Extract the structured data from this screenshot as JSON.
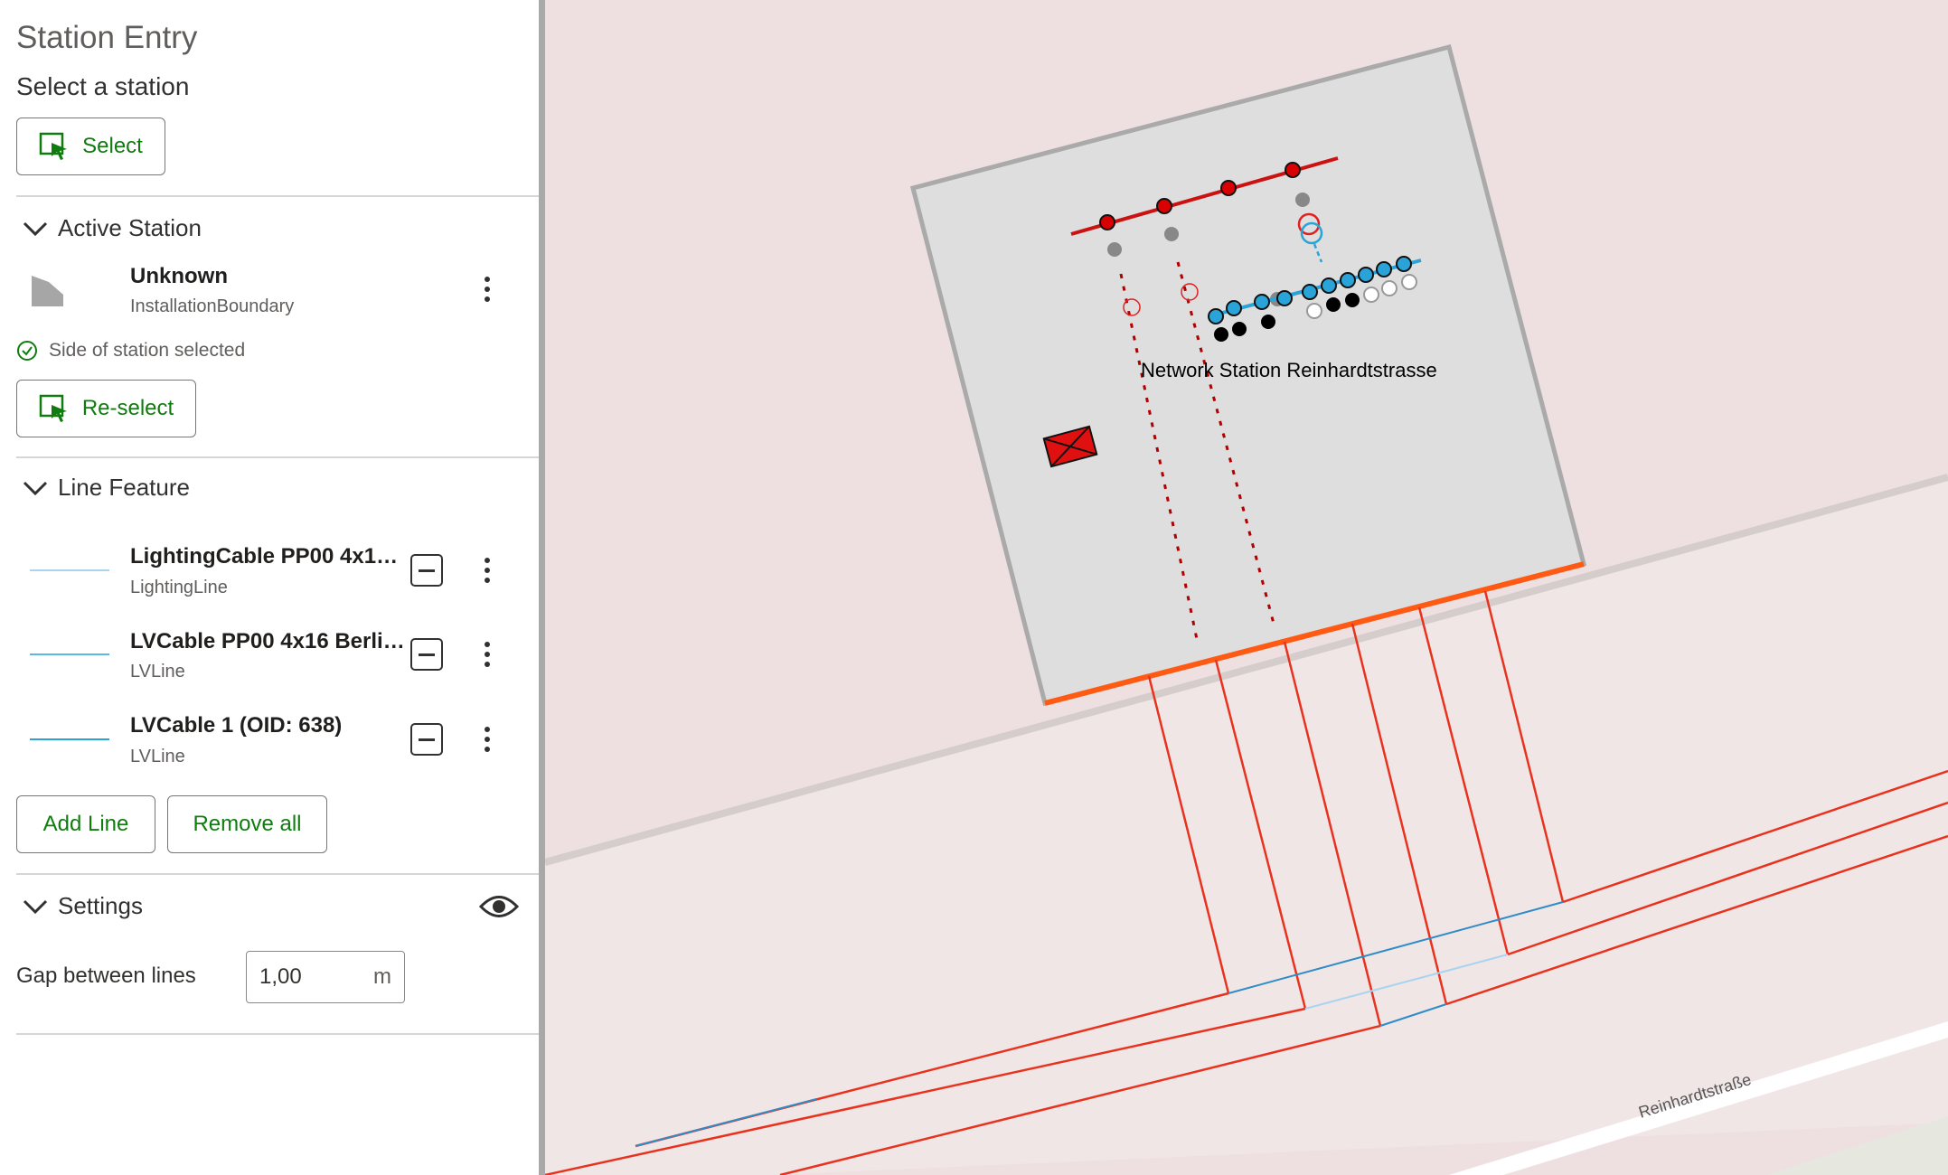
{
  "panel": {
    "title": "Station Entry",
    "subtitle": "Select a station",
    "select_button": "Select",
    "active_station": {
      "header": "Active Station",
      "name": "Unknown",
      "type": "InstallationBoundary",
      "status": "Side of station selected",
      "reselect_button": "Re-select"
    },
    "line_feature": {
      "header": "Line Feature",
      "items": [
        {
          "title": "LightingCable PP00 4x10 ...",
          "sub": "LightingLine",
          "swatch": "#a8d4f0"
        },
        {
          "title": "LVCable PP00 4x16 Berlin...",
          "sub": "LVLine",
          "swatch": "#5bb7e3"
        },
        {
          "title": "LVCable 1 (OID: 638)",
          "sub": "LVLine",
          "swatch": "#2aa3d8"
        }
      ],
      "add_button": "Add Line",
      "remove_button": "Remove all"
    },
    "settings": {
      "header": "Settings",
      "gap_label": "Gap between lines",
      "gap_value": "1,00",
      "gap_unit": "m"
    }
  },
  "map": {
    "station_label": "Network Station Reinhardtstrasse",
    "street_label": "Reinhardtstraße",
    "colors": {
      "background": "#eee0e0",
      "station_fill": "#dedede",
      "station_border": "#aaaaaa",
      "selected_side": "#ff5a14",
      "red_line": "#e8321e",
      "blue_line": "#2f8cc6"
    }
  }
}
